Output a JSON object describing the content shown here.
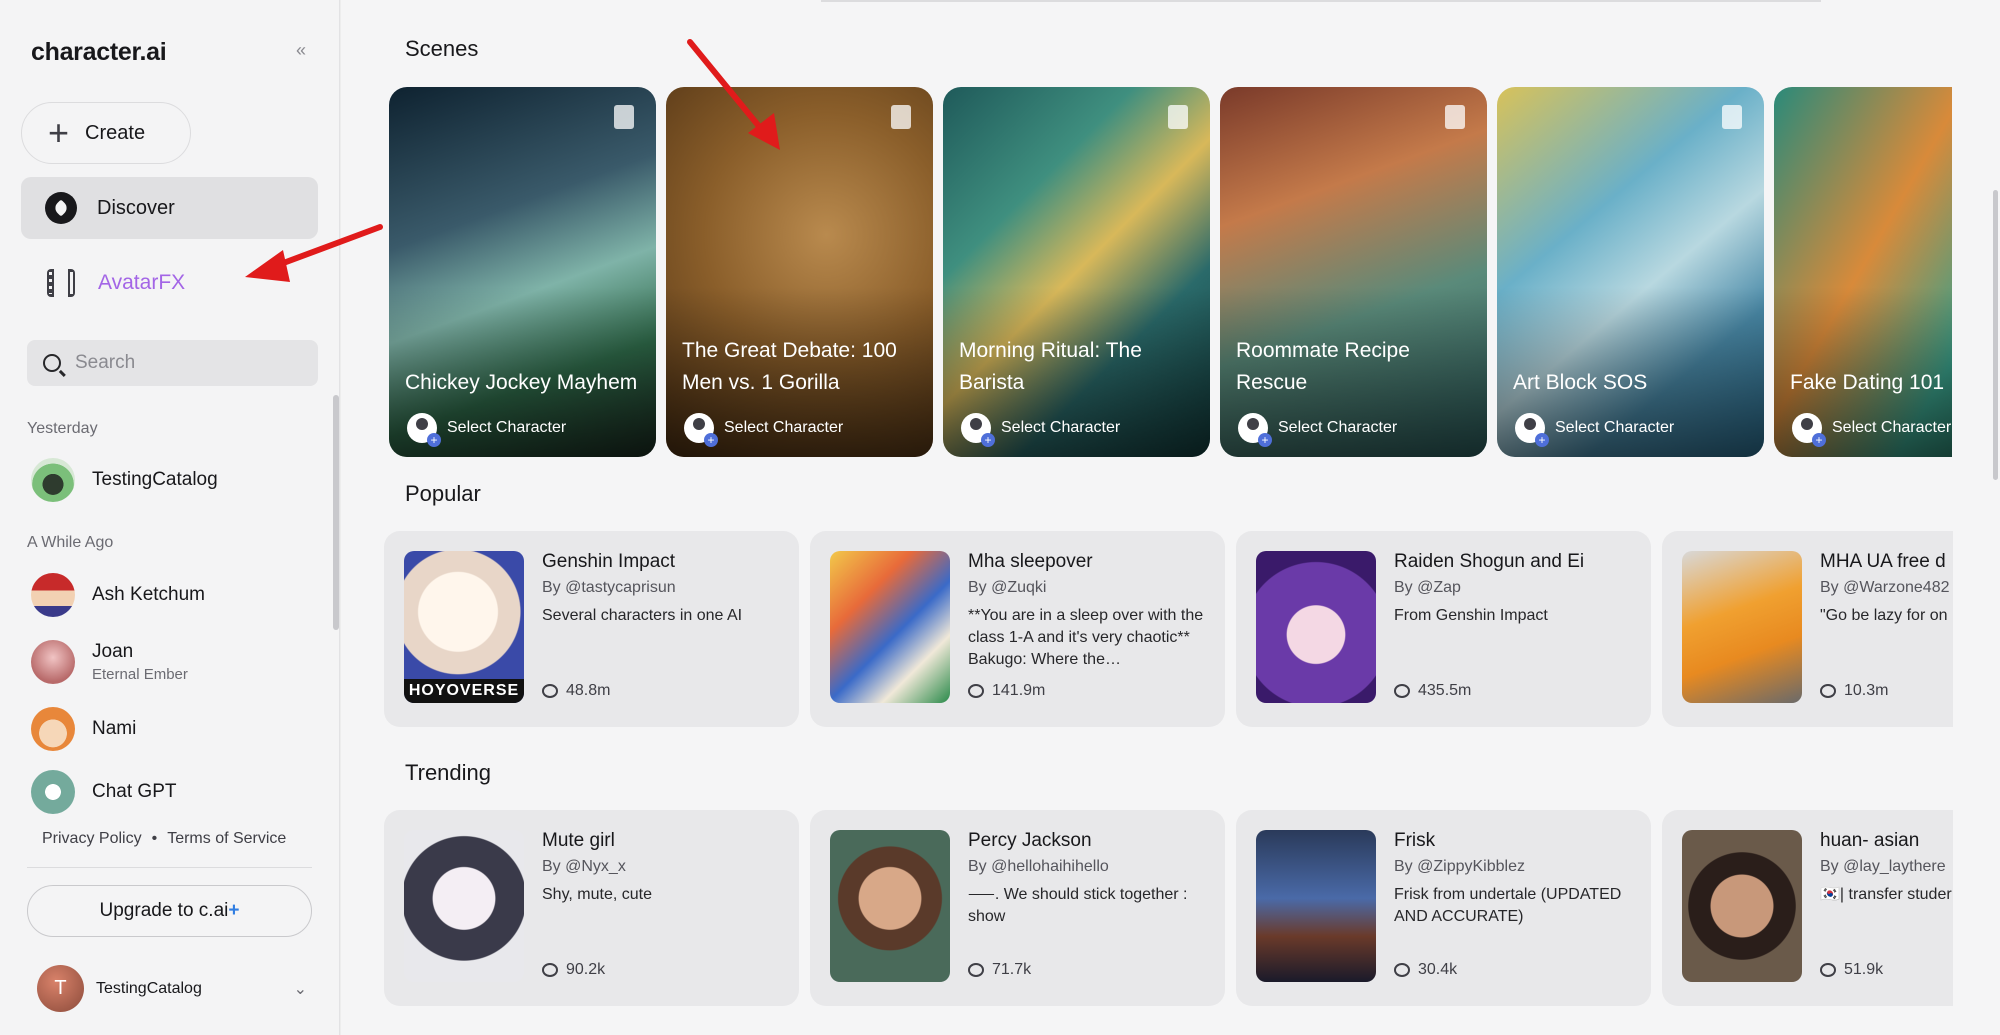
{
  "sidebar": {
    "logo": "character.ai",
    "collapse_icon": "«",
    "create_label": "Create",
    "discover_label": "Discover",
    "avatarfx_label": "AvatarFX",
    "search_placeholder": "Search",
    "section_yesterday": "Yesterday",
    "section_while_ago": "A While Ago",
    "chats": [
      {
        "name": "TestingCatalog",
        "sub": ""
      },
      {
        "name": "Ash Ketchum",
        "sub": ""
      },
      {
        "name": "Joan",
        "sub": "Eternal Ember"
      },
      {
        "name": "Nami",
        "sub": ""
      },
      {
        "name": "Chat GPT",
        "sub": ""
      }
    ],
    "privacy": "Privacy Policy",
    "dot": "•",
    "terms": "Terms of Service",
    "upgrade_label": "Upgrade to c.ai",
    "upgrade_plus": "+",
    "user_initial": "T",
    "user_name": "TestingCatalog"
  },
  "main": {
    "scenes_title": "Scenes",
    "scenes": [
      {
        "title": "Chickey Jockey Mayhem",
        "select": "Select Character"
      },
      {
        "title": "The Great Debate: 100 Men vs. 1 Gorilla",
        "select": "Select Character"
      },
      {
        "title": "Morning Ritual: The Barista",
        "select": "Select Character"
      },
      {
        "title": "Roommate Recipe Rescue",
        "select": "Select Character"
      },
      {
        "title": "Art Block SOS",
        "select": "Select Character"
      },
      {
        "title": "Fake Dating 101",
        "select": "Select Character"
      }
    ],
    "popular_title": "Popular",
    "popular": [
      {
        "name": "Genshin Impact",
        "by": "By @tastycaprisun",
        "desc": "Several characters in one AI",
        "count": "48.8m",
        "overlay": "HOYOVERSE"
      },
      {
        "name": "Mha sleepover",
        "by": "By @Zuqki",
        "desc": "**You are in a sleep over with the class 1-A and it's very chaotic** Bakugo: Where the…",
        "count": "141.9m"
      },
      {
        "name": "Raiden Shogun and Ei",
        "by": "By @Zap",
        "desc": "From Genshin Impact",
        "count": "435.5m"
      },
      {
        "name": "MHA UA free d",
        "by": "By @Warzone482",
        "desc": "\"Go be lazy for on month.\" -Nezu",
        "count": "10.3m"
      }
    ],
    "trending_title": "Trending",
    "trending": [
      {
        "name": "Mute girl",
        "by": "By @Nyx_x",
        "desc": "Shy, mute, cute",
        "count": "90.2k"
      },
      {
        "name": "Percy Jackson",
        "by": "By @hellohaihihello",
        "desc": "⸺. We should stick together : show",
        "count": "71.7k"
      },
      {
        "name": "Frisk",
        "by": "By @ZippyKibblez",
        "desc": "Frisk from undertale (UPDATED AND ACCURATE)",
        "count": "30.4k"
      },
      {
        "name": "huan- asian",
        "by": "By @lay_laythere",
        "desc": "🇰🇷| transfer studer",
        "count": "51.9k"
      }
    ]
  },
  "colors": {
    "accent_avatarfx": "#a365e6",
    "annotation_arrow": "#e01b1b",
    "upgrade_plus": "#2f7de1"
  }
}
